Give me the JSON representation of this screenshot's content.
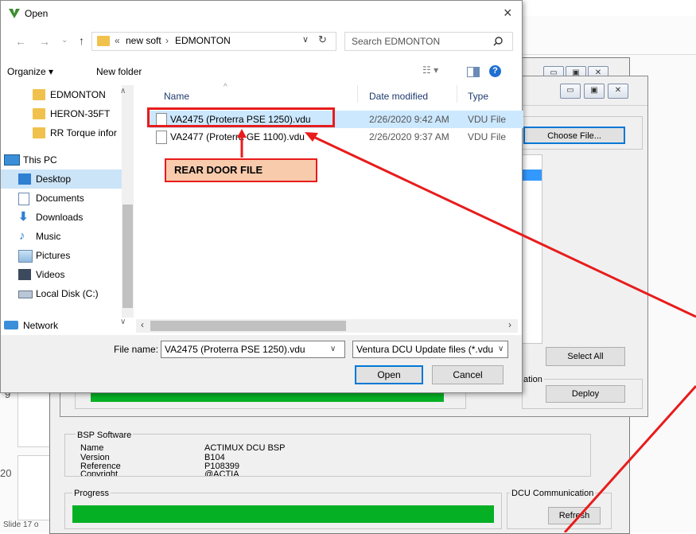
{
  "dialog": {
    "title": "Open",
    "close_icon": "×",
    "breadcrumb_prefix": "«",
    "breadcrumb_parent": "new soft",
    "breadcrumb_sep": "›",
    "breadcrumb_current": "EDMONTON",
    "search_placeholder": "Search EDMONTON",
    "organize_label": "Organize ▾",
    "new_folder_label": "New folder",
    "sidebar": [
      {
        "label": "EDMONTON",
        "icon": "folder-icon"
      },
      {
        "label": "HERON-35FT",
        "icon": "folder-icon"
      },
      {
        "label": "RR Torque infor",
        "icon": "folder-icon"
      },
      {
        "label": "This PC",
        "icon": "computer-icon"
      },
      {
        "label": "Desktop",
        "icon": "desktop-icon"
      },
      {
        "label": "Documents",
        "icon": "documents-icon"
      },
      {
        "label": "Downloads",
        "icon": "downloads-icon"
      },
      {
        "label": "Music",
        "icon": "music-icon"
      },
      {
        "label": "Pictures",
        "icon": "pictures-icon"
      },
      {
        "label": "Videos",
        "icon": "videos-icon"
      },
      {
        "label": "Local Disk (C:)",
        "icon": "disk-icon"
      },
      {
        "label": "Network",
        "icon": "network-icon"
      }
    ],
    "columns": {
      "name": "Name",
      "date": "Date modified",
      "type": "Type"
    },
    "files": [
      {
        "name": "VA2475 (Proterra PSE 1250).vdu",
        "date": "2/26/2020 9:42 AM",
        "type": "VDU File"
      },
      {
        "name": "VA2477 (Proterra GE 1100).vdu",
        "date": "2/26/2020 9:37 AM",
        "type": "VDU File"
      }
    ],
    "file_name_label": "File name:",
    "file_name_value": "VA2475 (Proterra PSE 1250).vdu",
    "filter_value": "Ventura DCU Update files (*.vdu",
    "open_label": "Open",
    "cancel_label": "Cancel"
  },
  "annotation": {
    "label": "REAR DOOR FILE",
    "color": "#e81c1c",
    "fill": "#f8cbad"
  },
  "background_app": {
    "choose_file_label": "Choose File...",
    "select_all_label": "Select All",
    "deploy_label": "Deploy",
    "ation_fragment": "ation",
    "bsp_title": "BSP Software",
    "bsp_rows": [
      {
        "key": "Name",
        "value": "ACTIMUX DCU BSP"
      },
      {
        "key": "Version",
        "value": "B104"
      },
      {
        "key": "Reference",
        "value": "P108399"
      },
      {
        "key": "Copyright",
        "value": "@ACTIA"
      }
    ],
    "progress_label": "Progress",
    "dcu_comm_label": "DCU Communication",
    "refresh_label": "Refresh",
    "slide_label": "Slide 17 o",
    "left_num_1": "9",
    "left_num_2": "20",
    "progress_color": "#06b025"
  }
}
